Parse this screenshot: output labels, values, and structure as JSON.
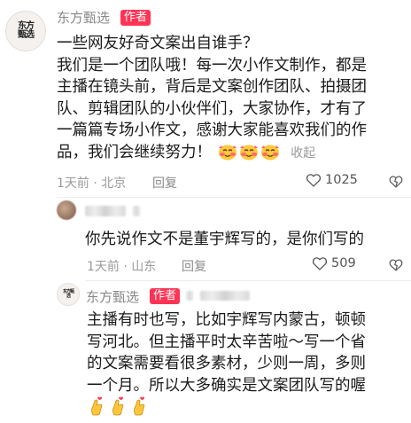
{
  "comment1": {
    "avatar_text": "东方甄选",
    "username": "东方甄选",
    "badge": "作者",
    "line0": "一些网友好奇文案出自谁手？",
    "line1": "我们是一个团队哦！每一次小作文制作，都是",
    "line2": "主播在镜头前，背后是文案创作团队、拍摄团",
    "line3": "队、剪辑团队的小伙伴们，大家协作，才有了",
    "line4": "一篇篇专场小作文，感谢大家能喜欢我们的作",
    "line5": "品，我们会继续努力！",
    "collapse": "收起",
    "time_location": "1天前 · 北京",
    "reply": "回复",
    "likes": "1025",
    "emojis": [
      "blush-emoji",
      "blush-emoji",
      "blush-emoji"
    ]
  },
  "reply1": {
    "text": "你先说作文不是董宇辉写的，是你们写的",
    "time_location": "1天前 · 山东",
    "reply": "回复",
    "likes": "509"
  },
  "reply2": {
    "avatar_text": "东方甄选",
    "username": "东方甄选",
    "badge": "作者",
    "line1": "主播有时也写，比如宇辉写内蒙古，顿顿",
    "line2": "写河北。但主播平时太辛苦啦～写一个省",
    "line3": "的文案需要看很多素材，少则一周，多则",
    "line4": "一个月。所以大多确实是文案团队写的喔",
    "emojis": [
      "finger-heart-emoji",
      "finger-heart-emoji",
      "finger-heart-emoji"
    ]
  },
  "colors": {
    "badge": "#ff3455",
    "meta": "#9a9a9a",
    "username": "#888888"
  }
}
